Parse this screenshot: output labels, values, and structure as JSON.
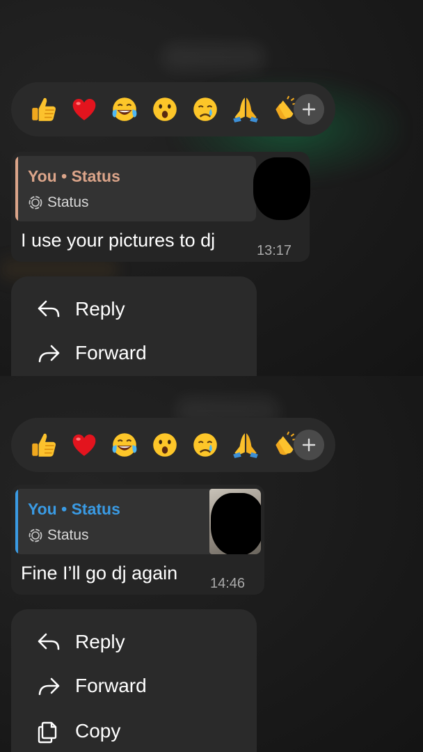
{
  "reactions": {
    "emojis": [
      {
        "icon": "thumbs-up-emoji",
        "glyph": "👍"
      },
      {
        "icon": "red-heart-emoji",
        "glyph": "❤️"
      },
      {
        "icon": "face-with-tears-of-joy-emoji",
        "glyph": "😂"
      },
      {
        "icon": "astonished-face-emoji",
        "glyph": "😮"
      },
      {
        "icon": "crying-face-emoji",
        "glyph": "😢"
      },
      {
        "icon": "folded-hands-emoji",
        "glyph": "🙏"
      },
      {
        "icon": "clapping-hands-emoji",
        "glyph": "👏"
      }
    ],
    "add_icon": "plus-icon"
  },
  "panels": [
    {
      "reply": {
        "title": "You • Status",
        "title_color": "#dca58a",
        "bar_color": "#dca58a",
        "subtitle": "Status",
        "subtitle_icon": "status-ring-icon"
      },
      "message": {
        "text": "I use your pictures to dj",
        "time": "13:17"
      },
      "menu": [
        {
          "label": "Reply",
          "icon": "reply-arrow-icon"
        },
        {
          "label": "Forward",
          "icon": "forward-arrow-icon"
        }
      ]
    },
    {
      "reply": {
        "title": "You • Status",
        "title_color": "#3a9be4",
        "bar_color": "#3a9be4",
        "subtitle": "Status",
        "subtitle_icon": "status-ring-icon"
      },
      "message": {
        "text": "Fine I’ll go dj again",
        "time": "14:46"
      },
      "menu": [
        {
          "label": "Reply",
          "icon": "reply-arrow-icon"
        },
        {
          "label": "Forward",
          "icon": "forward-arrow-icon"
        },
        {
          "label": "Copy",
          "icon": "copy-icon"
        }
      ]
    }
  ]
}
